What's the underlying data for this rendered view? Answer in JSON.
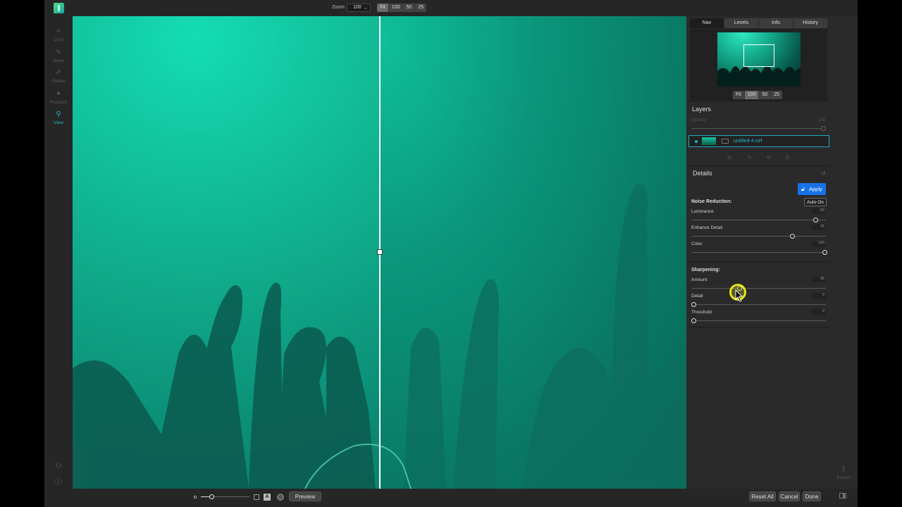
{
  "topbar": {
    "zoom_label": "Zoom",
    "zoom_value": "100",
    "zoom_buttons": [
      "Fit",
      "100",
      "50",
      "25"
    ]
  },
  "tools": [
    {
      "label": "Crop",
      "icon": "crop-icon"
    },
    {
      "label": "Mask",
      "icon": "brush-icon"
    },
    {
      "label": "Refine",
      "icon": "refine-brush-icon"
    },
    {
      "label": "Retouch",
      "icon": "retouch-icon"
    },
    {
      "label": "View",
      "icon": "view-magnifier-icon"
    }
  ],
  "panel": {
    "tabs": [
      "Nav",
      "Levels",
      "Info",
      "History"
    ],
    "active_tab": "Nav",
    "nav_zoom_buttons": [
      "Fit",
      "100",
      "50",
      "25"
    ],
    "layers_title": "Layers",
    "opacity_label": "Opacity",
    "opacity_value": "100",
    "layer_name": "untitled-4.nef",
    "details_title": "Details",
    "apply_label": "Apply",
    "auto_label": "Auto On",
    "noise_reduction_title": "Noise Reduction:",
    "sharpening_title": "Sharpening:",
    "noise_sliders": [
      {
        "label": "Luminance",
        "value": "93",
        "level": 0.93
      },
      {
        "label": "Enhance Detail",
        "value": "75",
        "level": 0.75
      },
      {
        "label": "Color",
        "value": "100",
        "level": 1.0
      }
    ],
    "sharp_sliders": [
      {
        "label": "Amount",
        "value": "35",
        "level": 0.35
      },
      {
        "label": "Detail",
        "value": "0",
        "level": 0.0
      },
      {
        "label": "Threshold",
        "value": "0",
        "level": 0.0
      }
    ]
  },
  "bottombar": {
    "preview_label": "Preview",
    "reset_label": "Reset All",
    "cancel_label": "Cancel",
    "done_label": "Done"
  },
  "export_label": "Export",
  "colors": {
    "accent": "#1eaec0",
    "apply_blue": "#1672e6",
    "cursor_highlight": "#e5e510"
  }
}
